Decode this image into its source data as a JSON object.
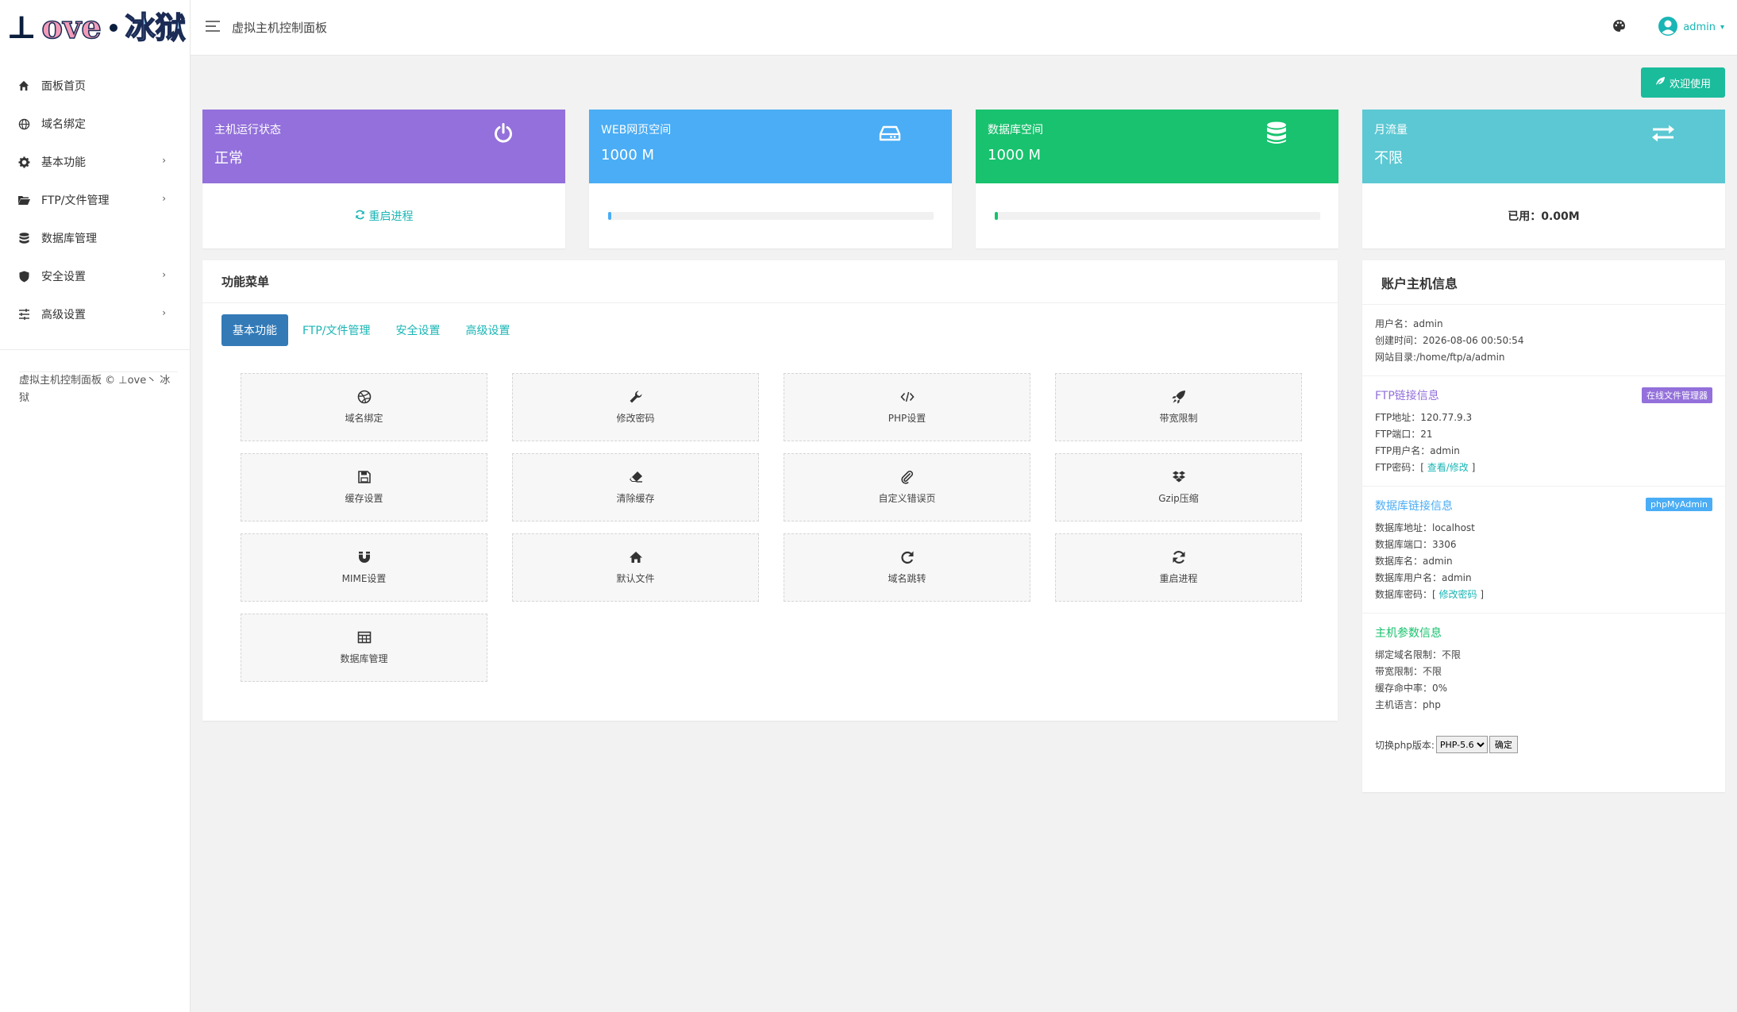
{
  "logo": {
    "mark": "⊥",
    "word": "ove",
    "cn": "冰狱"
  },
  "sidebar": {
    "items": [
      {
        "label": "面板首页",
        "icon": "home-icon",
        "has_arrow": false
      },
      {
        "label": "域名绑定",
        "icon": "globe-icon",
        "has_arrow": false
      },
      {
        "label": "基本功能",
        "icon": "gear-icon",
        "has_arrow": true
      },
      {
        "label": "FTP/文件管理",
        "icon": "folder-icon",
        "has_arrow": true
      },
      {
        "label": "数据库管理",
        "icon": "database-icon",
        "has_arrow": false
      },
      {
        "label": "安全设置",
        "icon": "shield-icon",
        "has_arrow": true
      },
      {
        "label": "高级设置",
        "icon": "sliders-icon",
        "has_arrow": true
      }
    ],
    "arrow": "›",
    "footer": "虚拟主机控制面板 © ⊥ove丶 冰狱"
  },
  "header": {
    "title": "虚拟主机控制面板",
    "user": "admin",
    "caret": "▾"
  },
  "welcome_button": "欢迎使用",
  "cards": [
    {
      "label": "主机运行状态",
      "value": "正常",
      "color": "#9370db",
      "icon": "power-icon",
      "footer_link": "重启进程"
    },
    {
      "label": "WEB网页空间",
      "value": "1000 M",
      "color": "#4aadf5",
      "icon": "hdd-icon",
      "progress": 0.01,
      "progress_color": "#4aadf5"
    },
    {
      "label": "数据库空间",
      "value": "1000 M",
      "color": "#18c26e",
      "icon": "database-icon",
      "progress": 0.01,
      "progress_color": "#18c26e"
    },
    {
      "label": "月流量",
      "value": "不限",
      "color": "#5bc8d3",
      "icon": "exchange-icon",
      "used": "已用：0.00M"
    }
  ],
  "function_menu": {
    "title": "功能菜单",
    "tabs": [
      "基本功能",
      "FTP/文件管理",
      "安全设置",
      "高级设置"
    ],
    "tiles": [
      {
        "label": "域名绑定",
        "icon": "dribbble-icon"
      },
      {
        "label": "修改密码",
        "icon": "wrench-icon"
      },
      {
        "label": "PHP设置",
        "icon": "code-icon"
      },
      {
        "label": "带宽限制",
        "icon": "rocket-icon"
      },
      {
        "label": "缓存设置",
        "icon": "save-icon"
      },
      {
        "label": "清除缓存",
        "icon": "eraser-icon"
      },
      {
        "label": "自定义错误页",
        "icon": "paperclip-icon"
      },
      {
        "label": "Gzip压缩",
        "icon": "dropbox-icon"
      },
      {
        "label": "MIME设置",
        "icon": "magnet-icon"
      },
      {
        "label": "默认文件",
        "icon": "home-icon"
      },
      {
        "label": "域名跳转",
        "icon": "redo-icon"
      },
      {
        "label": "重启进程",
        "icon": "refresh-icon"
      },
      {
        "label": "数据库管理",
        "icon": "table-icon"
      }
    ]
  },
  "account": {
    "title": "账户主机信息",
    "basic": [
      "用户名：admin",
      "创建时间：2026-08-06 00:50:54",
      "网站目录:/home/ftp/a/admin"
    ],
    "ftp": {
      "title": "FTP链接信息",
      "title_color": "#9370db",
      "badge": "在线文件管理器",
      "badge_color": "#9370db",
      "rows": [
        "FTP地址：120.77.9.3",
        "FTP端口：21",
        "FTP用户名：admin"
      ],
      "password_prefix": "FTP密码：[ ",
      "password_link": "查看/修改",
      "password_suffix": " ]"
    },
    "db": {
      "title": "数据库链接信息",
      "title_color": "#4aadf5",
      "badge": "phpMyAdmin",
      "badge_color": "#4aadf5",
      "rows": [
        "数据库地址：localhost",
        "数据库端口：3306",
        "数据库名：admin",
        "数据库用户名：admin"
      ],
      "password_prefix": "数据库密码：[ ",
      "password_link": "修改密码",
      "password_suffix": " ]"
    },
    "params": {
      "title": "主机参数信息",
      "title_color": "#18c26e",
      "rows": [
        "绑定域名限制：不限",
        "带宽限制：不限",
        "缓存命中率：0%",
        "主机语言：php"
      ]
    },
    "switch": {
      "label": "切换php版本:",
      "selected": "PHP-5.6",
      "button": "确定"
    }
  }
}
